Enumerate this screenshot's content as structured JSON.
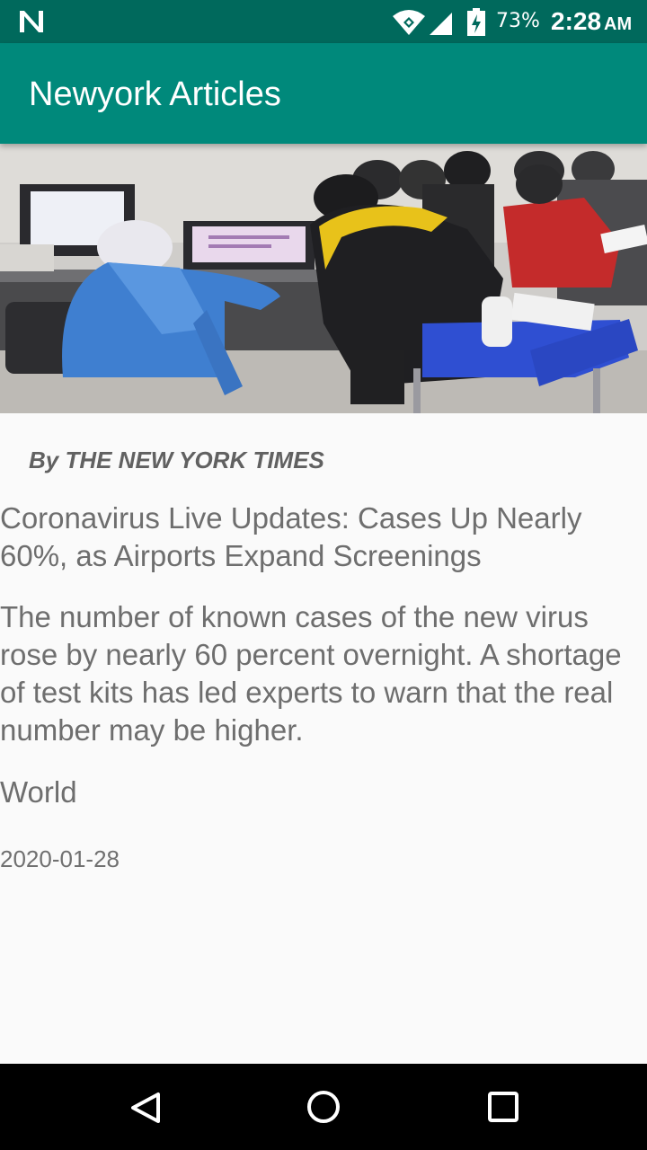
{
  "status_bar": {
    "battery": "73%",
    "time": "2:28",
    "ampm": "AM",
    "icons": [
      "n-notification-icon",
      "wifi-icon",
      "cell-signal-icon",
      "battery-charging-icon"
    ]
  },
  "app_bar": {
    "title": "Newyork Articles",
    "color": "#00897b"
  },
  "article": {
    "image_alt": "hospital-scene-photo",
    "byline": "By THE NEW YORK TIMES",
    "headline": "Coronavirus Live Updates: Cases Up Nearly 60%, as Airports Expand Screenings",
    "summary": "The number of known cases of the new virus rose by nearly 60 percent overnight. A shortage of test kits has led experts to warn that the real number may be higher.",
    "section": "World",
    "date": "2020-01-28"
  },
  "nav_bar": {
    "icons": [
      "back-icon",
      "home-icon",
      "recents-icon"
    ]
  }
}
